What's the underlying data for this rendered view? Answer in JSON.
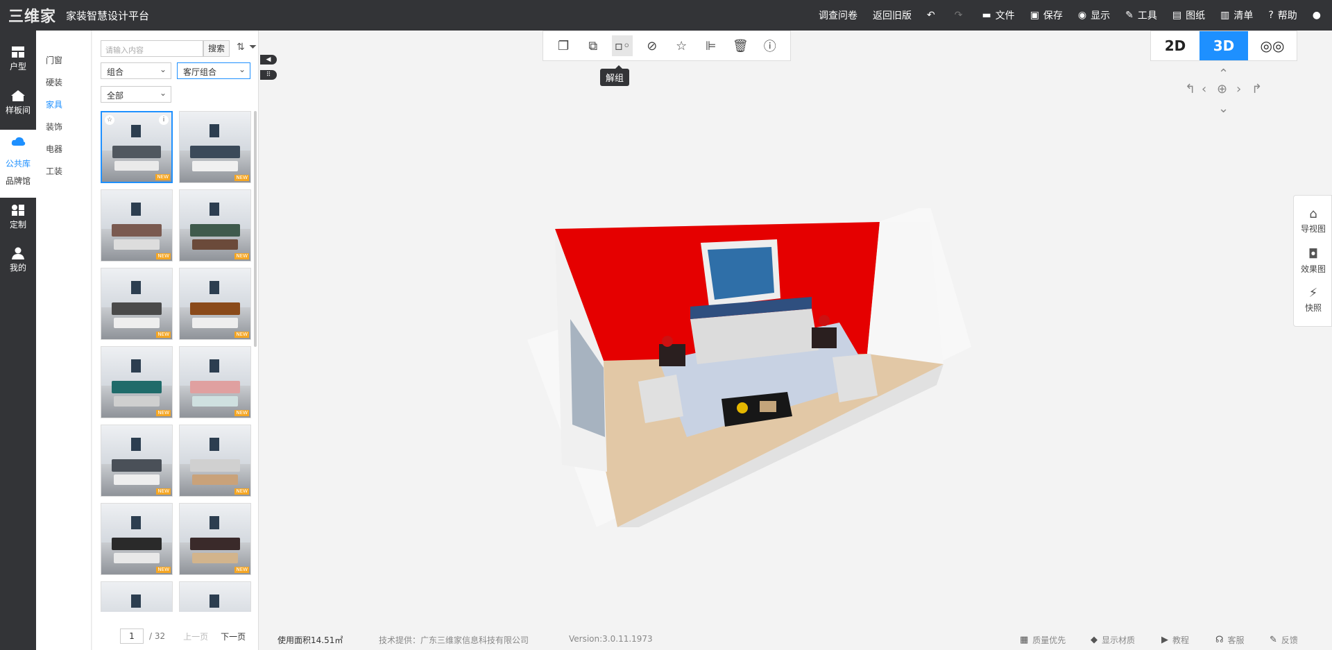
{
  "app": {
    "logo_text": "三维家",
    "subtitle": "家装智慧设计平台"
  },
  "top_menu": [
    {
      "label": "调查问卷",
      "icon": ""
    },
    {
      "label": "返回旧版",
      "icon": ""
    },
    {
      "label": "",
      "icon": "undo-icon"
    },
    {
      "label": "",
      "icon": "redo-icon"
    },
    {
      "label": "文件",
      "icon": "folder-icon"
    },
    {
      "label": "保存",
      "icon": "save-icon"
    },
    {
      "label": "显示",
      "icon": "eye-icon"
    },
    {
      "label": "工具",
      "icon": "wrench-icon"
    },
    {
      "label": "图纸",
      "icon": "map-icon"
    },
    {
      "label": "清单",
      "icon": "list-icon"
    },
    {
      "label": "帮助",
      "icon": "help-icon"
    },
    {
      "label": "",
      "icon": "user-icon"
    }
  ],
  "left_nav": [
    {
      "label": "户型",
      "icon": "floorplan-icon"
    },
    {
      "label": "样板间",
      "icon": "house-icon"
    },
    {
      "label": "公共库",
      "icon": "cloud-icon"
    },
    {
      "label": "品牌馆",
      "icon": ""
    },
    {
      "label": "定制",
      "icon": "grid-icon"
    },
    {
      "label": "我的",
      "icon": "user-icon"
    }
  ],
  "categories": [
    "门窗",
    "硬装",
    "家具",
    "装饰",
    "电器",
    "工装"
  ],
  "active_category": "家具",
  "panel": {
    "search_placeholder": "请输入内容",
    "search_button": "搜索",
    "filter_1": "组合",
    "filter_2": "客厅组合",
    "filter_3": "全部",
    "new_badge": "NEW",
    "page_current": "1",
    "page_total": "/ 32",
    "prev_page": "上一页",
    "next_page": "下一页"
  },
  "toolbar": {
    "icons": [
      "copy-icon",
      "group-icon",
      "ungroup-icon",
      "hide-icon",
      "favorite-icon",
      "align-icon",
      "delete-icon",
      "info-icon"
    ],
    "active_index": 2,
    "tooltip": "解组"
  },
  "view_switch": [
    "2D",
    "3D",
    "VR"
  ],
  "active_view": "3D",
  "right_panel": [
    {
      "label": "导视图",
      "icon": "nav-view-icon"
    },
    {
      "label": "效果图",
      "icon": "camera-icon"
    },
    {
      "label": "快照",
      "icon": "snapshot-icon"
    }
  ],
  "status": {
    "area": "使用面积14.51㎡",
    "provider": "技术提供：广东三维家信息科技有限公司",
    "version": "Version:3.0.11.1973",
    "quality": "质量优先",
    "material": "显示材质",
    "tutorial": "教程",
    "service": "客服",
    "feedback": "反馈"
  },
  "colors": {
    "accent": "#1e90ff",
    "dark_bar": "#333437",
    "accent_wall": "#e50000"
  }
}
